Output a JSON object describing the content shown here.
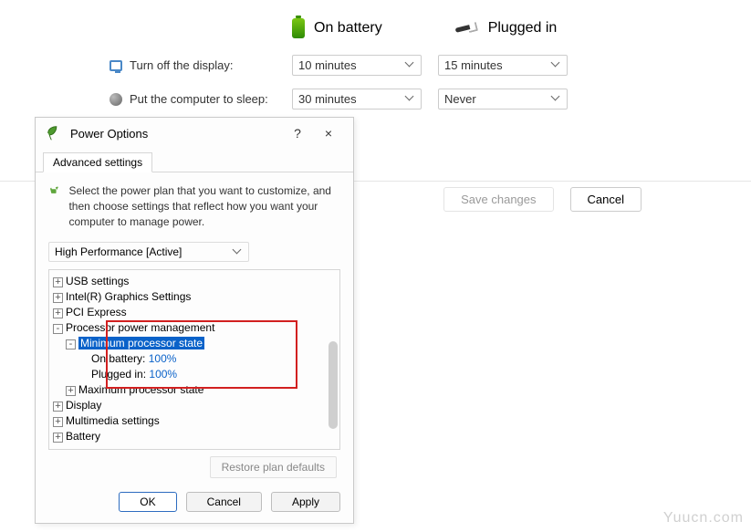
{
  "header": {
    "battery_label": "On battery",
    "plugged_label": "Plugged in"
  },
  "rows": {
    "display_label": "Turn off the display:",
    "display_battery": "10 minutes",
    "display_plugged": "15 minutes",
    "sleep_label": "Put the computer to sleep:",
    "sleep_battery": "30 minutes",
    "sleep_plugged": "Never"
  },
  "footer": {
    "save": "Save changes",
    "cancel": "Cancel"
  },
  "dialog": {
    "title": "Power Options",
    "help": "?",
    "close": "×",
    "tab": "Advanced settings",
    "description": "Select the power plan that you want to customize, and then choose settings that reflect how you want your computer to manage power.",
    "plan": "High Performance [Active]",
    "tree": {
      "usb": "USB settings",
      "gfx": "Intel(R) Graphics Settings",
      "pci": "PCI Express",
      "ppm": "Processor power management",
      "min_state": "Minimum processor state",
      "on_battery": "On battery:",
      "on_battery_val": "100%",
      "plugged": "Plugged in:",
      "plugged_val": "100%",
      "max_state": "Maximum processor state",
      "display": "Display",
      "multimedia": "Multimedia settings",
      "battery": "Battery"
    },
    "restore": "Restore plan defaults",
    "ok": "OK",
    "cancel": "Cancel",
    "apply": "Apply"
  },
  "watermark": "Yuucn.com"
}
